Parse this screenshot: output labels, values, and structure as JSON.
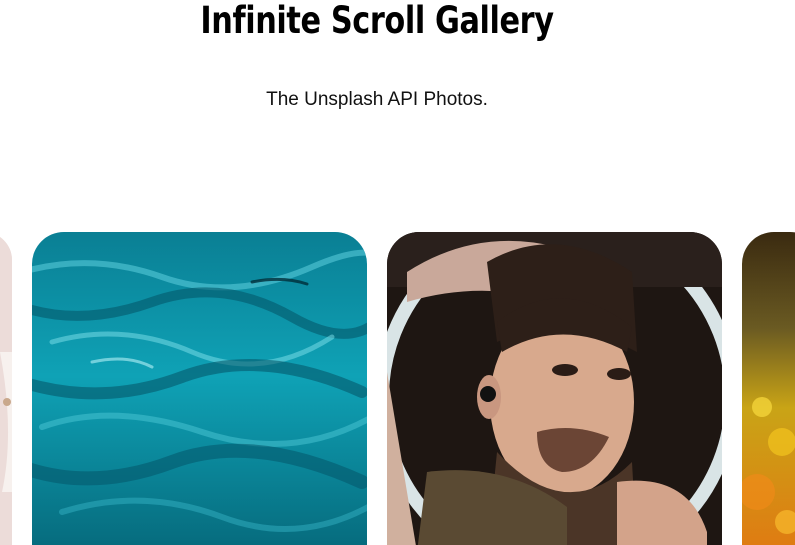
{
  "header": {
    "title": "Infinite Scroll Gallery",
    "subtitle": "The Unsplash API Photos."
  },
  "gallery": {
    "photos": [
      {
        "subject": "partial-photo-left"
      },
      {
        "subject": "water-surface-photo"
      },
      {
        "subject": "man-portrait-photo"
      },
      {
        "subject": "partial-photo-right"
      }
    ]
  },
  "colors": {
    "water": "#0c8ea4",
    "background": "#ffffff",
    "text": "#000000"
  }
}
